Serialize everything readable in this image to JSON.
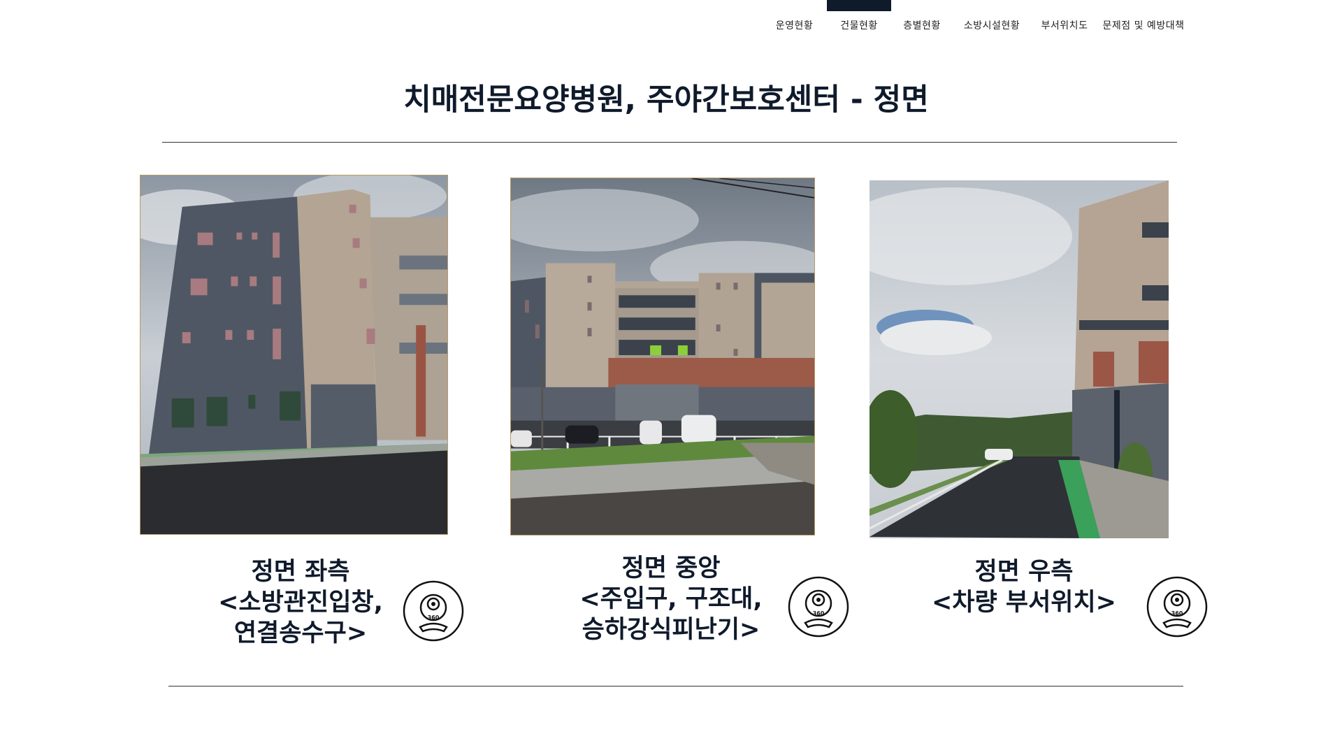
{
  "nav": {
    "items": [
      {
        "label": "운영현황",
        "active": false
      },
      {
        "label": "건물현황",
        "active": true
      },
      {
        "label": "층별현황",
        "active": false
      },
      {
        "label": "소방시설현황",
        "active": false
      },
      {
        "label": "부서위치도",
        "active": false
      },
      {
        "label": "문제점 및 예방대책",
        "active": false
      }
    ],
    "active_color": "#0f1a2b"
  },
  "page": {
    "title": "치매전문요양병원, 주야간보호센터 - 정면"
  },
  "views": [
    {
      "line1": "정면 좌측",
      "line2": "<소방관진입창,",
      "line3": "연결송수구>",
      "icon": "360-camera-icon"
    },
    {
      "line1": "정면 중앙",
      "line2": "<주입구, 구조대,",
      "line3": "승하강식피난기>",
      "icon": "360-camera-icon"
    },
    {
      "line1": "정면 우측",
      "line2": "<차량 부서위치>",
      "line3": "",
      "icon": "360-camera-icon"
    }
  ],
  "icon_label": "360",
  "colors": {
    "title": "#0f1a2b",
    "photo_border": "#b89968"
  }
}
